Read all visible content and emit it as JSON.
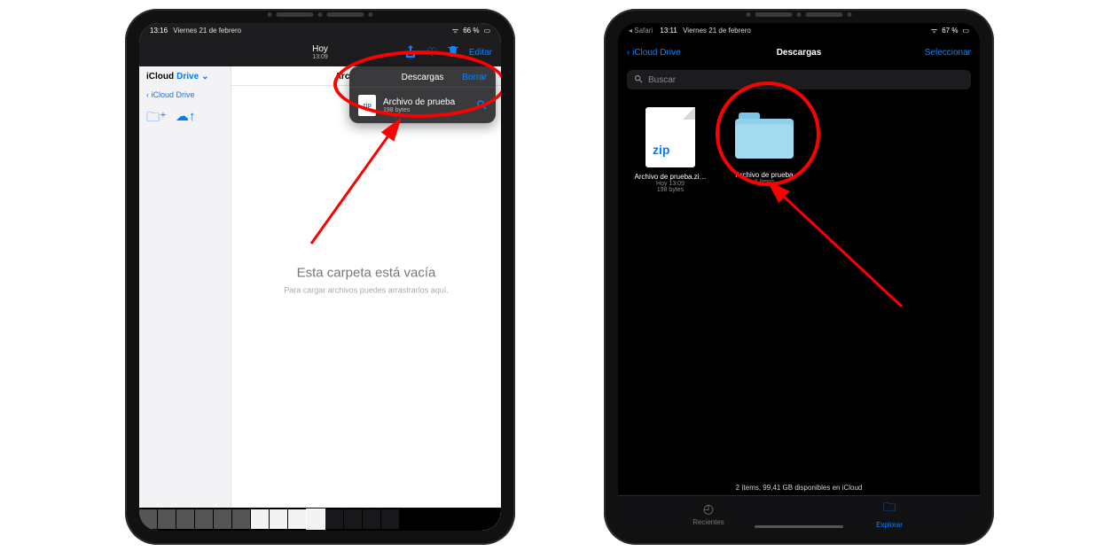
{
  "left": {
    "status": {
      "time": "13:16",
      "date": "Viernes 21 de febrero",
      "battery": "66 %"
    },
    "topbar": {
      "title": "Hoy",
      "subtitle": "13:09",
      "edit": "Editar"
    },
    "sidebar": {
      "title_prefix": "iCloud ",
      "title_link": "Drive",
      "back": "iCloud Drive"
    },
    "content_tab": "Archivo de pru",
    "empty": {
      "title": "Esta carpeta está vacía",
      "subtitle": "Para cargar archivos puedes arrastrarlos aquí."
    },
    "popover": {
      "title": "Descargas",
      "clear": "Borrar",
      "item_name": "Archivo de prueba",
      "item_size": "198 bytes",
      "thumb_label": "zip"
    }
  },
  "right": {
    "status": {
      "app": "Safari",
      "time": "13:11",
      "date": "Viernes 21 de febrero",
      "battery": "67 %"
    },
    "nav": {
      "back": "iCloud Drive",
      "title": "Descargas",
      "select": "Seleccionar"
    },
    "search_placeholder": "Buscar",
    "files": {
      "zip": {
        "label": "zip",
        "name": "Archivo de prueba.zi…",
        "line2": "Hoy 13:09",
        "line3": "198 bytes"
      },
      "folder": {
        "name": "Archivo de prueba",
        "line2": "0 ítems"
      }
    },
    "bottom_status": "2 ítems, 99,41 GB disponibles en iCloud",
    "tabs": {
      "recents": "Recientes",
      "browse": "Explorar"
    }
  }
}
